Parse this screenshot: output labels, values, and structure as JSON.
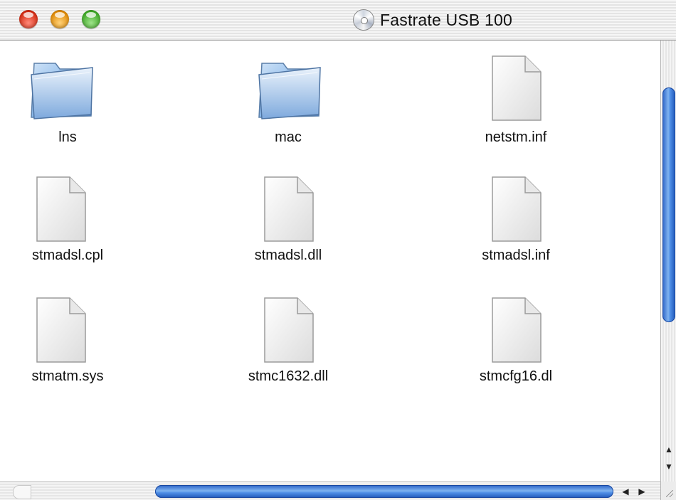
{
  "window": {
    "title": "Fastrate USB 100",
    "title_icon": "cd-disk-icon"
  },
  "items": [
    {
      "name": "lns",
      "type": "folder",
      "label": "lns"
    },
    {
      "name": "mac",
      "type": "folder",
      "label": "mac"
    },
    {
      "name": "netstm-inf",
      "type": "file",
      "label": "netstm.inf"
    },
    {
      "name": "stmadsl-cpl",
      "type": "file",
      "label": "stmadsl.cpl"
    },
    {
      "name": "stmadsl-dll",
      "type": "file",
      "label": "stmadsl.dll"
    },
    {
      "name": "stmadsl-inf",
      "type": "file",
      "label": "stmadsl.inf"
    },
    {
      "name": "stmatm-sys",
      "type": "file",
      "label": "stmatm.sys"
    },
    {
      "name": "stmc1632-dll",
      "type": "file",
      "label": "stmc1632.dll"
    },
    {
      "name": "stmcfg16-dl",
      "type": "file",
      "label": "stmcfg16.dl"
    }
  ],
  "colors": {
    "scroll_thumb": "#4f8ee6",
    "close": "#d42a12",
    "minimize": "#e08a05",
    "zoom": "#3ea826"
  }
}
